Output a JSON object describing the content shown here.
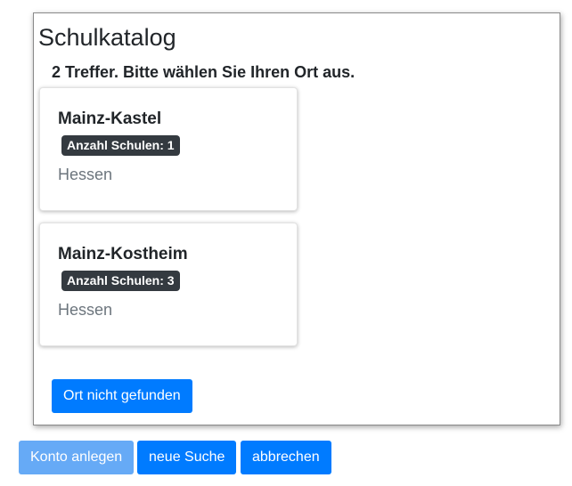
{
  "dialog": {
    "title": "Schulkatalog",
    "result_text": "2 Treffer. Bitte wählen Sie Ihren Ort aus.",
    "results": [
      {
        "name": "Mainz-Kastel",
        "badge": "Anzahl Schulen: 1",
        "state": "Hessen"
      },
      {
        "name": "Mainz-Kostheim",
        "badge": "Anzahl Schulen: 3",
        "state": "Hessen"
      }
    ],
    "not_found_label": "Ort nicht gefunden"
  },
  "footer": {
    "create_account_label": "Konto anlegen",
    "new_search_label": "neue Suche",
    "cancel_label": "abbrechen"
  },
  "colors": {
    "primary": "#007bff",
    "primary_disabled": "#66aaf6",
    "badge_bg": "#343a40",
    "muted_text": "#6c757d"
  }
}
